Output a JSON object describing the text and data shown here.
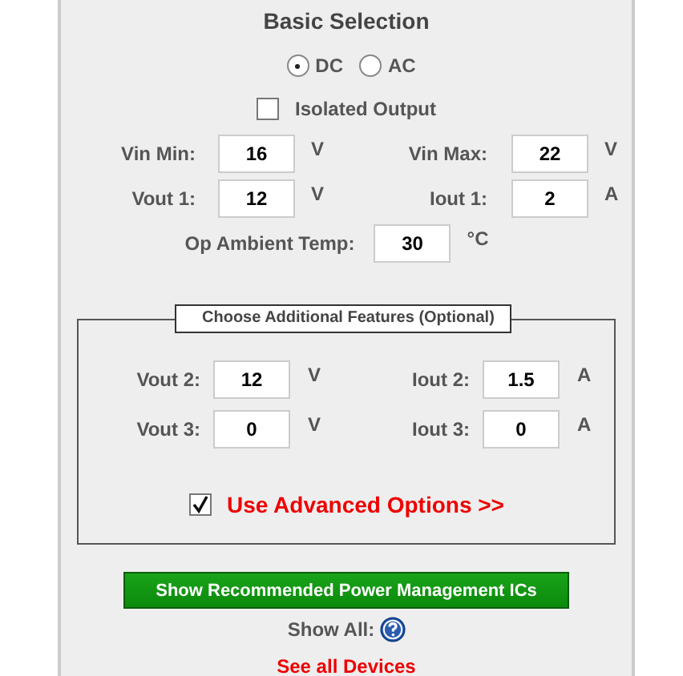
{
  "title": "Basic Selection",
  "power_type": [
    {
      "label": "DC",
      "selected": true
    },
    {
      "label": "AC",
      "selected": false
    }
  ],
  "isolated_output": {
    "label": "Isolated Output",
    "checked": false
  },
  "fields": [
    {
      "label": "Vin Min:",
      "value": "16",
      "unit": "V"
    },
    {
      "label": "Vin Max:",
      "value": "22",
      "unit": "V"
    },
    {
      "label": "Vout 1:",
      "value": "12",
      "unit": "V"
    },
    {
      "label": "Iout 1:",
      "value": "2",
      "unit": "A"
    }
  ],
  "ambient_temp": {
    "label": "Op Ambient Temp:",
    "value": "30",
    "unit": "°C"
  },
  "features": {
    "legend": "Choose Additional Features (Optional)",
    "fields": [
      {
        "label": "Vout 2:",
        "value": "12",
        "unit": "V"
      },
      {
        "label": "Iout 2:",
        "value": "1.5",
        "unit": "A"
      },
      {
        "label": "Vout 3:",
        "value": "0",
        "unit": "V"
      },
      {
        "label": "Iout 3:",
        "value": "0",
        "unit": "A"
      }
    ],
    "advanced": {
      "label": "Use Advanced Options >>",
      "checked": true
    }
  },
  "button": "Show Recommended Power Management ICs",
  "show_all": "Show All:",
  "link": "See all Devices"
}
